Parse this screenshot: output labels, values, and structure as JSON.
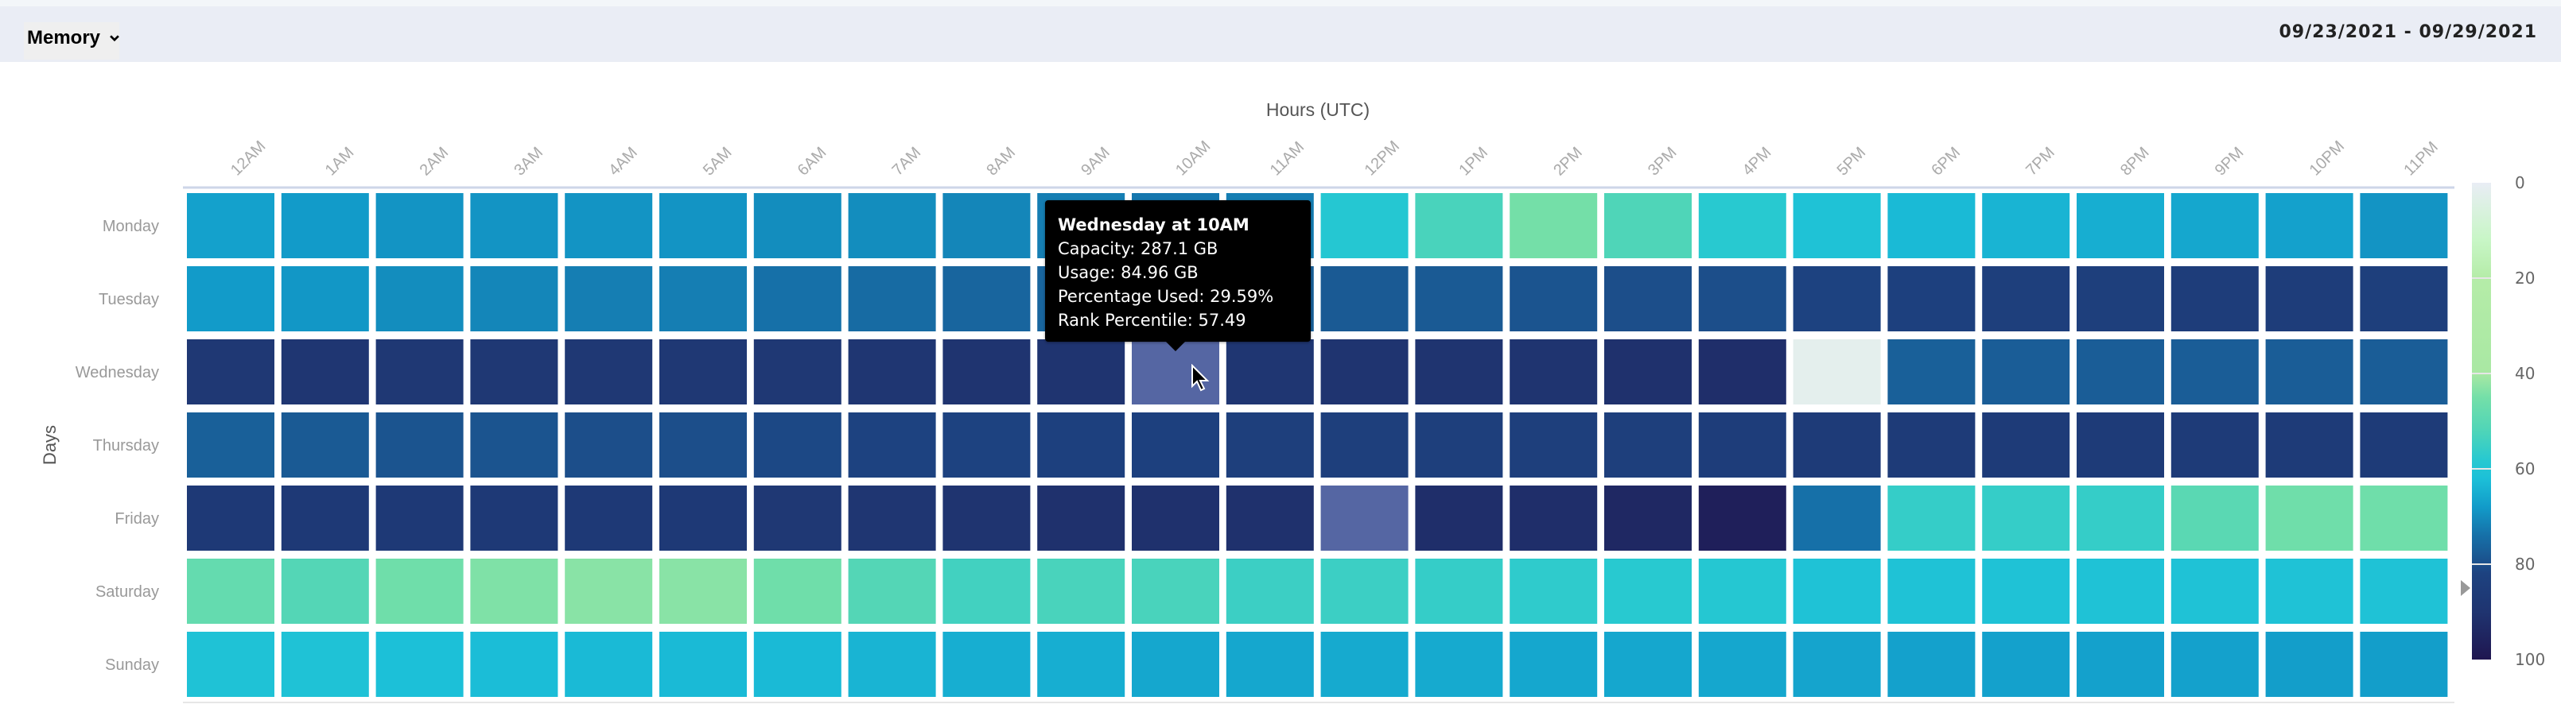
{
  "toolbar": {
    "metric_label": "Memory",
    "metric_icon": "chevron-down-icon",
    "date_range": "09/23/2021 - 09/29/2021"
  },
  "tooltip": {
    "title": "Wednesday at 10AM",
    "capacity": "Capacity: 287.1 GB",
    "usage": "Usage: 84.96 GB",
    "percentage_used": "Percentage Used: 29.59%",
    "rank_percentile": "Rank Percentile: 57.49"
  },
  "chart_data": {
    "type": "heatmap",
    "title": "",
    "xlabel": "Hours (UTC)",
    "ylabel": "Days",
    "x": [
      "12AM",
      "1AM",
      "2AM",
      "3AM",
      "4AM",
      "5AM",
      "6AM",
      "7AM",
      "8AM",
      "9AM",
      "10AM",
      "11AM",
      "12PM",
      "1PM",
      "2PM",
      "3PM",
      "4PM",
      "5PM",
      "6PM",
      "7PM",
      "8PM",
      "9PM",
      "10PM",
      "11PM"
    ],
    "y": [
      "Monday",
      "Tuesday",
      "Wednesday",
      "Thursday",
      "Friday",
      "Saturday",
      "Sunday"
    ],
    "values": [
      [
        67,
        68,
        69,
        69,
        69,
        69,
        70,
        70,
        71,
        72,
        73,
        72,
        59,
        53,
        45,
        52,
        58,
        61,
        63,
        64,
        65,
        66,
        67,
        69
      ],
      [
        68,
        68.5,
        70,
        71,
        72,
        72,
        74,
        75,
        76,
        76,
        76,
        77,
        78,
        78,
        79,
        80,
        80,
        82,
        83,
        84,
        84,
        85,
        85,
        84
      ],
      [
        88,
        89,
        88,
        88,
        88,
        88,
        88,
        89,
        90,
        90,
        null,
        89,
        90,
        90,
        90,
        91,
        92,
        2,
        77,
        77.5,
        77.5,
        77.5,
        77.5,
        77.5
      ],
      [
        77,
        78,
        79,
        79,
        80,
        80,
        81,
        82,
        82,
        83,
        83,
        84,
        84,
        84,
        84,
        84,
        85,
        86,
        86,
        86,
        86,
        86,
        86,
        86
      ],
      [
        87,
        87,
        87,
        87,
        87,
        87,
        88,
        89,
        90,
        91,
        91,
        91,
        null,
        92,
        92,
        94,
        97,
        74,
        56,
        56,
        56,
        50,
        46,
        46
      ],
      [
        48,
        51,
        46,
        44,
        43,
        43,
        46,
        51,
        54,
        53,
        53,
        55,
        55,
        56,
        57,
        58,
        59,
        61,
        61,
        61,
        61,
        61,
        61,
        61
      ],
      [
        61,
        61,
        62,
        62.5,
        63,
        63,
        63,
        64,
        65,
        65,
        66,
        66,
        65.5,
        65.5,
        66,
        66,
        66,
        66.5,
        67,
        67,
        67,
        67,
        67.5,
        67.5
      ]
    ],
    "highlighted_cells": [
      {
        "day": "Wednesday",
        "hour": "10AM"
      },
      {
        "day": "Friday",
        "hour": "12PM"
      }
    ],
    "highlight_color": "#5566a3",
    "colorbar": {
      "range": [
        0,
        100
      ],
      "ticks": [
        "0",
        "20",
        "40",
        "60",
        "80",
        "100"
      ],
      "pointer_value": 85,
      "stops": [
        [
          0,
          "#e9edf5"
        ],
        [
          12,
          "#c8f6c6"
        ],
        [
          20,
          "#b5eca8"
        ],
        [
          40,
          "#a9e8a3"
        ],
        [
          45,
          "#74dfa8"
        ],
        [
          52,
          "#4fd5b8"
        ],
        [
          58,
          "#28c9d0"
        ],
        [
          62,
          "#1cc0d8"
        ],
        [
          68,
          "#129bc9"
        ],
        [
          74,
          "#1670a8"
        ],
        [
          78,
          "#1a5a94"
        ],
        [
          82,
          "#1d4280"
        ],
        [
          90,
          "#1f3470"
        ],
        [
          100,
          "#1f1650"
        ]
      ]
    }
  }
}
